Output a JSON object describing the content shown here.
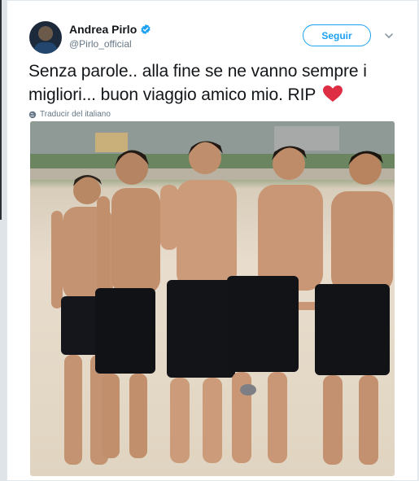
{
  "tweet": {
    "author": {
      "display_name": "Andrea Pirlo",
      "handle": "@Pirlo_official",
      "verified": true
    },
    "follow_label": "Seguir",
    "text_main": "Senza parole.. alla fine se ne vanno sempre i migliori... buon viaggio amico mio. RIP",
    "translate_label": "Traducir del italiano",
    "icons": {
      "verified": "verified-badge-icon",
      "more": "chevron-down-icon",
      "translate": "globe-icon",
      "emoji": "red-heart-icon"
    },
    "colors": {
      "accent": "#1da1f2",
      "text": "#14171a",
      "secondary": "#657786",
      "heart": "#e0245e"
    }
  }
}
